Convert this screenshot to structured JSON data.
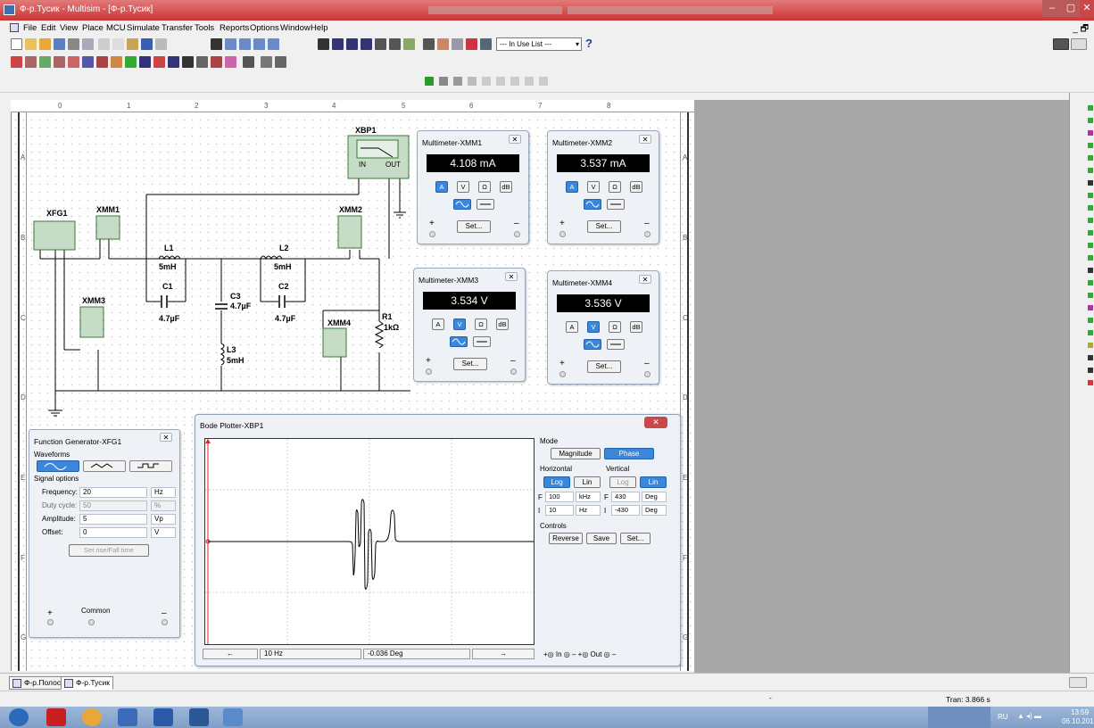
{
  "window": {
    "title": "Ф-р.Тусик - Multisim - [Ф-р.Тусик]",
    "minimize": "–",
    "maximize": "▢",
    "close": "✕"
  },
  "menu": {
    "items": [
      "File",
      "Edit",
      "View",
      "Place",
      "MCU",
      "Simulate",
      "Transfer",
      "Tools",
      "Reports",
      "Options",
      "Window",
      "Help"
    ],
    "mdi": "_ 🗗"
  },
  "toolbar": {
    "in_use_list": "--- In Use List ---",
    "help": "?"
  },
  "ruler": {
    "columns": [
      "0",
      "1",
      "2",
      "3",
      "4",
      "5",
      "6",
      "7",
      "8"
    ],
    "rows": [
      "A",
      "B",
      "C",
      "D",
      "E",
      "F",
      "G"
    ]
  },
  "circuit": {
    "xbp1": "XBP1",
    "xbp1_in": "IN",
    "xbp1_out": "OUT",
    "xfg1": "XFG1",
    "xmm1": "XMM1",
    "xmm2": "XMM2",
    "xmm3": "XMM3",
    "xmm4": "XMM4",
    "l1": "L1",
    "l1_val": "5mH",
    "l2": "L2",
    "l2_val": "5mH",
    "l3": "L3",
    "l3_val": "5mH",
    "c1": "C1",
    "c1_val": "4.7µF",
    "c2": "C2",
    "c2_val": "4.7µF",
    "c3": "C3",
    "c3_val": "4.7µF",
    "r1": "R1",
    "r1_val": "1kΩ"
  },
  "multimeters": [
    {
      "title": "Multimeter-XMM1",
      "reading": "4.108 mA",
      "active_mode": "A",
      "close": "✕",
      "set": "Set..."
    },
    {
      "title": "Multimeter-XMM2",
      "reading": "3.537 mA",
      "active_mode": "A",
      "close": "✕",
      "set": "Set..."
    },
    {
      "title": "Multimeter-XMM3",
      "reading": "3.534 V",
      "active_mode": "V",
      "close": "✕",
      "set": "Set..."
    },
    {
      "title": "Multimeter-XMM4",
      "reading": "3.536 V",
      "active_mode": "V",
      "close": "✕",
      "set": "Set..."
    }
  ],
  "mm_buttons": {
    "a": "A",
    "v": "V",
    "ohm": "Ω",
    "db": "dB",
    "plus": "+",
    "minus": "–"
  },
  "function_generator": {
    "title": "Function Generator-XFG1",
    "close": "✕",
    "waveforms_label": "Waveforms",
    "signal_options_label": "Signal options",
    "frequency_label": "Frequency:",
    "frequency_value": "20",
    "frequency_unit": "Hz",
    "duty_label": "Duty cycle:",
    "duty_value": "50",
    "duty_unit": "%",
    "amplitude_label": "Amplitude:",
    "amplitude_value": "5",
    "amplitude_unit": "Vp",
    "offset_label": "Offset:",
    "offset_value": "0",
    "offset_unit": "V",
    "rise_fall_button": "Set rise/Fall time",
    "plus": "+",
    "common": "Common",
    "minus": "–"
  },
  "bode": {
    "title": "Bode Plotter-XBP1",
    "close": "✕",
    "mode_label": "Mode",
    "magnitude": "Magnitude",
    "phase": "Phase",
    "horizontal_label": "Horizontal",
    "vertical_label": "Vertical",
    "log": "Log",
    "lin": "Lin",
    "h_f_prefix": "F",
    "h_f_value": "100",
    "h_f_unit": "kHz",
    "h_i_prefix": "I",
    "h_i_value": "10",
    "h_i_unit": "Hz",
    "v_f_prefix": "F",
    "v_f_value": "430",
    "v_f_unit": "Deg",
    "v_i_prefix": "I",
    "v_i_value": "-430",
    "v_i_unit": "Deg",
    "controls_label": "Controls",
    "reverse": "Reverse",
    "save": "Save",
    "set": "Set...",
    "cursor_freq": "10 Hz",
    "cursor_value": "-0.036 Deg",
    "left_arrow": "←",
    "right_arrow": "→",
    "terminals": "+◎ In ◎ –    +◎ Out ◎ –"
  },
  "tabs": [
    "Ф-р.Полос.",
    "Ф-р.Тусик"
  ],
  "status": {
    "tran": "Tran: 3.866 s"
  },
  "taskbar": {
    "lang": "RU",
    "time": "13:59",
    "date": "06.10.2018"
  }
}
